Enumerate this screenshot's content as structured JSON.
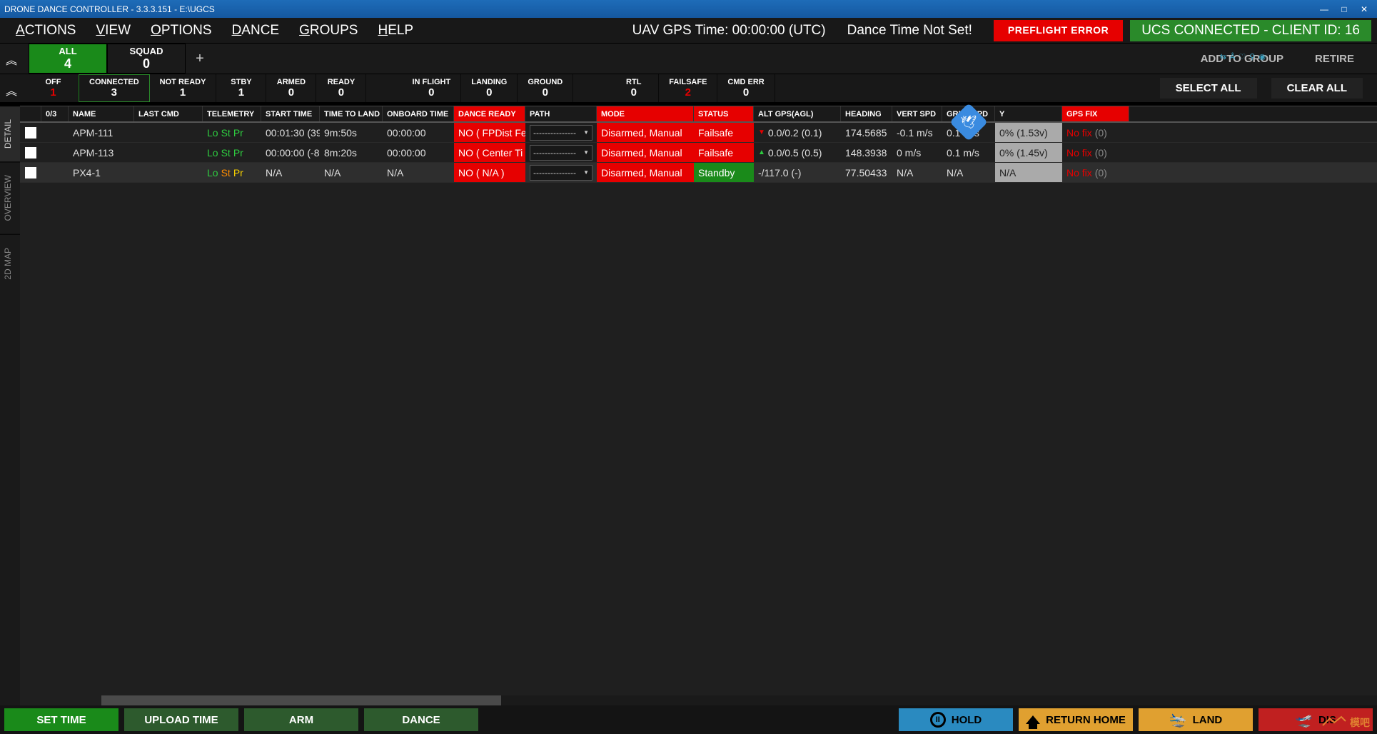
{
  "window": {
    "title": "DRONE DANCE CONTROLLER - 3.3.3.151 - E:\\UGCS"
  },
  "menu": {
    "actions": "CTIONS",
    "view": "IEW",
    "options": "PTIONS",
    "dance": "ANCE",
    "groups": "ROUPS",
    "help": "ELP",
    "gps_time": "UAV GPS Time: 00:00:00 (UTC)",
    "dance_time": "Dance Time Not Set!",
    "preflight": "PREFLIGHT ERROR",
    "ucs": "UCS CONNECTED - CLIENT ID: 16"
  },
  "tabs": {
    "all_label": "ALL",
    "all_val": "4",
    "squad_label": "SQUAD",
    "squad_val": "0",
    "add_to_group": "ADD TO GROUP",
    "retire": "RETIRE",
    "watermark": "⇆ Å ♡ ⚲ ◉"
  },
  "status": {
    "off_l": "OFF",
    "off_v": "1",
    "conn_l": "CONNECTED",
    "conn_v": "3",
    "nr_l": "NOT READY",
    "nr_v": "1",
    "stby_l": "STBY",
    "stby_v": "1",
    "armed_l": "ARMED",
    "armed_v": "0",
    "ready_l": "READY",
    "ready_v": "0",
    "inf_l": "IN FLIGHT",
    "inf_v": "0",
    "land_l": "LANDING",
    "land_v": "0",
    "ground_l": "GROUND",
    "ground_v": "0",
    "rtl_l": "RTL",
    "rtl_v": "0",
    "fail_l": "FAILSAFE",
    "fail_v": "2",
    "cmd_l": "CMD ERR",
    "cmd_v": "0",
    "select_all": "SELECT ALL",
    "clear_all": "CLEAR ALL"
  },
  "sidetabs": {
    "detail": "DETAIL",
    "overview": "OVERVIEW",
    "map": "2D MAP"
  },
  "columns": {
    "idx": "0/3",
    "name": "NAME",
    "lastcmd": "LAST CMD",
    "telem": "TELEMETRY",
    "start": "START TIME",
    "ttl": "TIME TO LAND",
    "onboard": "ONBOARD TIME",
    "dance": "DANCE READY",
    "path": "PATH",
    "mode": "MODE",
    "status": "STATUS",
    "alt": "ALT GPS(AGL)",
    "heading": "HEADING",
    "vspd": "VERT SPD",
    "gspd": "GRND SPD",
    "batt": "Y",
    "gps": "GPS FIX"
  },
  "rows": [
    {
      "name": "APM-111",
      "telem": [
        {
          "t": "Lo",
          "c": "g"
        },
        {
          "t": "St",
          "c": "g"
        },
        {
          "t": "Pr",
          "c": "g"
        }
      ],
      "start": "00:01:30 (39",
      "ttl": "9m:50s",
      "onboard": "00:00:00",
      "dance": "NO ( FPDist Fe",
      "pathsel": "---------------",
      "mode": "Disarmed, Manual",
      "status": "Failsafe",
      "status_color": "red",
      "alt_arrow": "dn",
      "alt": "0.0/0.2 (0.1)",
      "heading": "174.5685",
      "vspd": "-0.1 m/s",
      "gspd": "0.1 m/s",
      "batt": "0% (1.53v)",
      "gps": "No fix",
      "gps_cnt": "(0)"
    },
    {
      "name": "APM-113",
      "telem": [
        {
          "t": "Lo",
          "c": "g"
        },
        {
          "t": "St",
          "c": "g"
        },
        {
          "t": "Pr",
          "c": "g"
        }
      ],
      "start": "00:00:00 (-8",
      "ttl": "8m:20s",
      "onboard": "00:00:00",
      "dance": "NO ( Center Ti",
      "pathsel": "---------------",
      "mode": "Disarmed, Manual",
      "status": "Failsafe",
      "status_color": "red",
      "alt_arrow": "up",
      "alt": "0.0/0.5 (0.5)",
      "heading": "148.3938",
      "vspd": "0 m/s",
      "gspd": "0.1 m/s",
      "batt": "0% (1.45v)",
      "gps": "No fix",
      "gps_cnt": "(0)"
    },
    {
      "name": "PX4-1",
      "telem": [
        {
          "t": "Lo",
          "c": "g"
        },
        {
          "t": "St",
          "c": "o"
        },
        {
          "t": "Pr",
          "c": "y"
        }
      ],
      "start": "N/A",
      "ttl": "N/A",
      "onboard": "N/A",
      "dance": "NO ( N/A )",
      "pathsel": "---------------",
      "mode": "Disarmed, Manual",
      "status": "Standby",
      "status_color": "green",
      "alt_arrow": "",
      "alt": "-/117.0 (-)",
      "heading": "77.50433",
      "vspd": "N/A",
      "gspd": "N/A",
      "batt": "N/A",
      "gps": "No fix",
      "gps_cnt": "(0)"
    }
  ],
  "bottom": {
    "set_time": "SET TIME",
    "upload_time": "UPLOAD TIME",
    "arm": "ARM",
    "dance": "DANCE",
    "hold": "HOLD",
    "return_home": "RETURN HOME",
    "land": "LAND",
    "disarm": "DIS"
  },
  "logo": "模吧"
}
